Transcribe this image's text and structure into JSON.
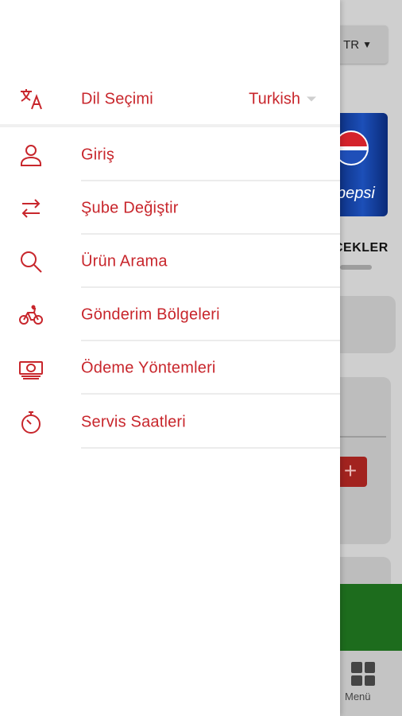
{
  "background": {
    "language_button": "TR",
    "category_label": "CEKLER",
    "product_brand": "pepsi",
    "add_button": "+",
    "bottom_nav": {
      "menu_label": "Menü"
    }
  },
  "drawer": {
    "language": {
      "label": "Dil Seçimi",
      "value": "Turkish",
      "icon": "translate-icon"
    },
    "items": [
      {
        "label": "Giriş",
        "icon": "user-icon"
      },
      {
        "label": "Şube Değiştir",
        "icon": "swap-icon"
      },
      {
        "label": "Ürün Arama",
        "icon": "search-icon"
      },
      {
        "label": "Gönderim Bölgeleri",
        "icon": "bicycle-icon"
      },
      {
        "label": "Ödeme Yöntemleri",
        "icon": "money-icon"
      },
      {
        "label": "Servis Saatleri",
        "icon": "timer-icon"
      }
    ]
  },
  "colors": {
    "accent": "#c8262c",
    "divider": "#ececec"
  }
}
